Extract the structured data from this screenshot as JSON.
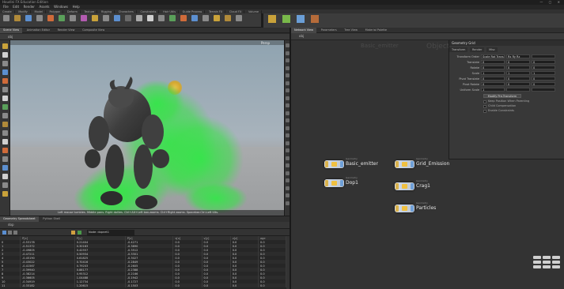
{
  "app": {
    "title_bar": "Houdini FX Education Edition",
    "window_controls": "— ▢ ✕",
    "menu": [
      "File",
      "Edit",
      "Render",
      "Assets",
      "Windows",
      "Help"
    ]
  },
  "left_desk": {
    "shelf_tabs": [
      "Create",
      "Modify",
      "Model",
      "Polygon",
      "Deform",
      "Texture",
      "Rigging",
      "Characters",
      "Constraints",
      "Hair Utils",
      "Guide Process",
      "Terrain FX",
      "Cloud FX",
      "Volume"
    ],
    "pane_tabs": [
      "Scene View",
      "Animation Editor",
      "Render View",
      "Composite View"
    ],
    "path": "obj",
    "viewport": {
      "camera_label": "Persp",
      "status_text": "Left mouse tumbles. Middle pans. Right dollies. Ctrl+Alt+Left box-zooms. Ctrl+Right zooms. Spacebar-Ctrl-Left tilts."
    },
    "spreadsheet": {
      "pane_tabs": [
        "Geometry Spreadsheet",
        "Python Shell"
      ],
      "path": "dop",
      "toolbar_field": "Node: dopnet1",
      "columns": [
        "",
        "P[x]",
        "P[y]",
        "P[z]",
        "v[x]",
        "v[y]",
        "v[z]",
        "age"
      ],
      "rows": [
        [
          "0",
          "-0.53178",
          "0.21404",
          "-0.4271",
          "0.0",
          "0.0",
          "0.0",
          "0.0"
        ],
        [
          "1",
          "-0.51372",
          "0.30163",
          "-0.3890",
          "0.0",
          "0.0",
          "0.0",
          "0.0"
        ],
        [
          "2",
          "-0.49805",
          "0.42557",
          "-0.3512",
          "0.0",
          "0.0",
          "0.0",
          "0.0"
        ],
        [
          "3",
          "-0.47211",
          "0.50934",
          "-0.3301",
          "0.0",
          "0.0",
          "0.0",
          "0.0"
        ],
        [
          "4",
          "-0.45190",
          "0.61825",
          "-0.3027",
          "0.0",
          "0.0",
          "0.0",
          "0.0"
        ],
        [
          "5",
          "-0.43022",
          "0.70416",
          "-0.2849",
          "0.0",
          "0.0",
          "0.0",
          "0.0"
        ],
        [
          "6",
          "-0.41567",
          "0.79203",
          "-0.2605",
          "0.0",
          "0.0",
          "0.0",
          "0.0"
        ],
        [
          "7",
          "-0.39940",
          "0.88177",
          "-0.2388",
          "0.0",
          "0.0",
          "0.0",
          "0.0"
        ],
        [
          "8",
          "-0.38214",
          "0.95312",
          "-0.2166",
          "0.0",
          "0.0",
          "0.0",
          "0.0"
        ],
        [
          "9",
          "-0.36605",
          "1.04488",
          "-0.1942",
          "0.0",
          "0.0",
          "0.0",
          "0.0"
        ],
        [
          "10",
          "-0.34919",
          "1.12734",
          "-0.1727",
          "0.0",
          "0.0",
          "0.0",
          "0.0"
        ],
        [
          "11",
          "-0.33182",
          "1.20615",
          "-0.1503",
          "0.0",
          "0.0",
          "0.0",
          "0.0"
        ]
      ]
    }
  },
  "right_desk": {
    "pane_tabs": [
      "Network View",
      "Parameters",
      "Tree View",
      "Material Palette"
    ],
    "path": "obj",
    "network_context": "Objects",
    "network_watermark_left": "Basic_emitter",
    "nodes": [
      {
        "name": "Basic_emitter",
        "type": "Geometry"
      },
      {
        "name": "Grid_Emission",
        "type": "Geometry"
      },
      {
        "name": "Dop1",
        "type": "Geometry"
      },
      {
        "name": "Crag1",
        "type": "Geometry"
      },
      {
        "name": "Particles",
        "type": "Geometry"
      }
    ],
    "params": {
      "header": "Geometry Grid",
      "tabs": [
        "Transform",
        "Render",
        "Misc"
      ],
      "rows": [
        {
          "label": "Transform Order",
          "values": [
            "Scale Rot Trans",
            "Rx Ry Rz",
            ""
          ]
        },
        {
          "label": "Translate",
          "values": [
            "0",
            "0",
            "0"
          ]
        },
        {
          "label": "Rotate",
          "values": [
            "0",
            "0",
            "0"
          ]
        },
        {
          "label": "Scale",
          "values": [
            "1",
            "1",
            "1"
          ]
        },
        {
          "label": "Pivot Translate",
          "values": [
            "0",
            "0",
            "0"
          ]
        },
        {
          "label": "Pivot Rotate",
          "values": [
            "0",
            "0",
            "0"
          ]
        },
        {
          "label": "Uniform Scale",
          "values": [
            "1",
            "",
            ""
          ]
        }
      ],
      "modify_button": "Modify Pre-Transform",
      "checkboxes": [
        "Keep Position When Parenting",
        "Child Compensation",
        "Enable Constraints"
      ]
    }
  },
  "colors": {
    "accent_node_flag": "#d9b24c",
    "node_display_flag": "#6fa0d8",
    "particle_green": "#3ee04a",
    "sun": "#e9c24a"
  }
}
